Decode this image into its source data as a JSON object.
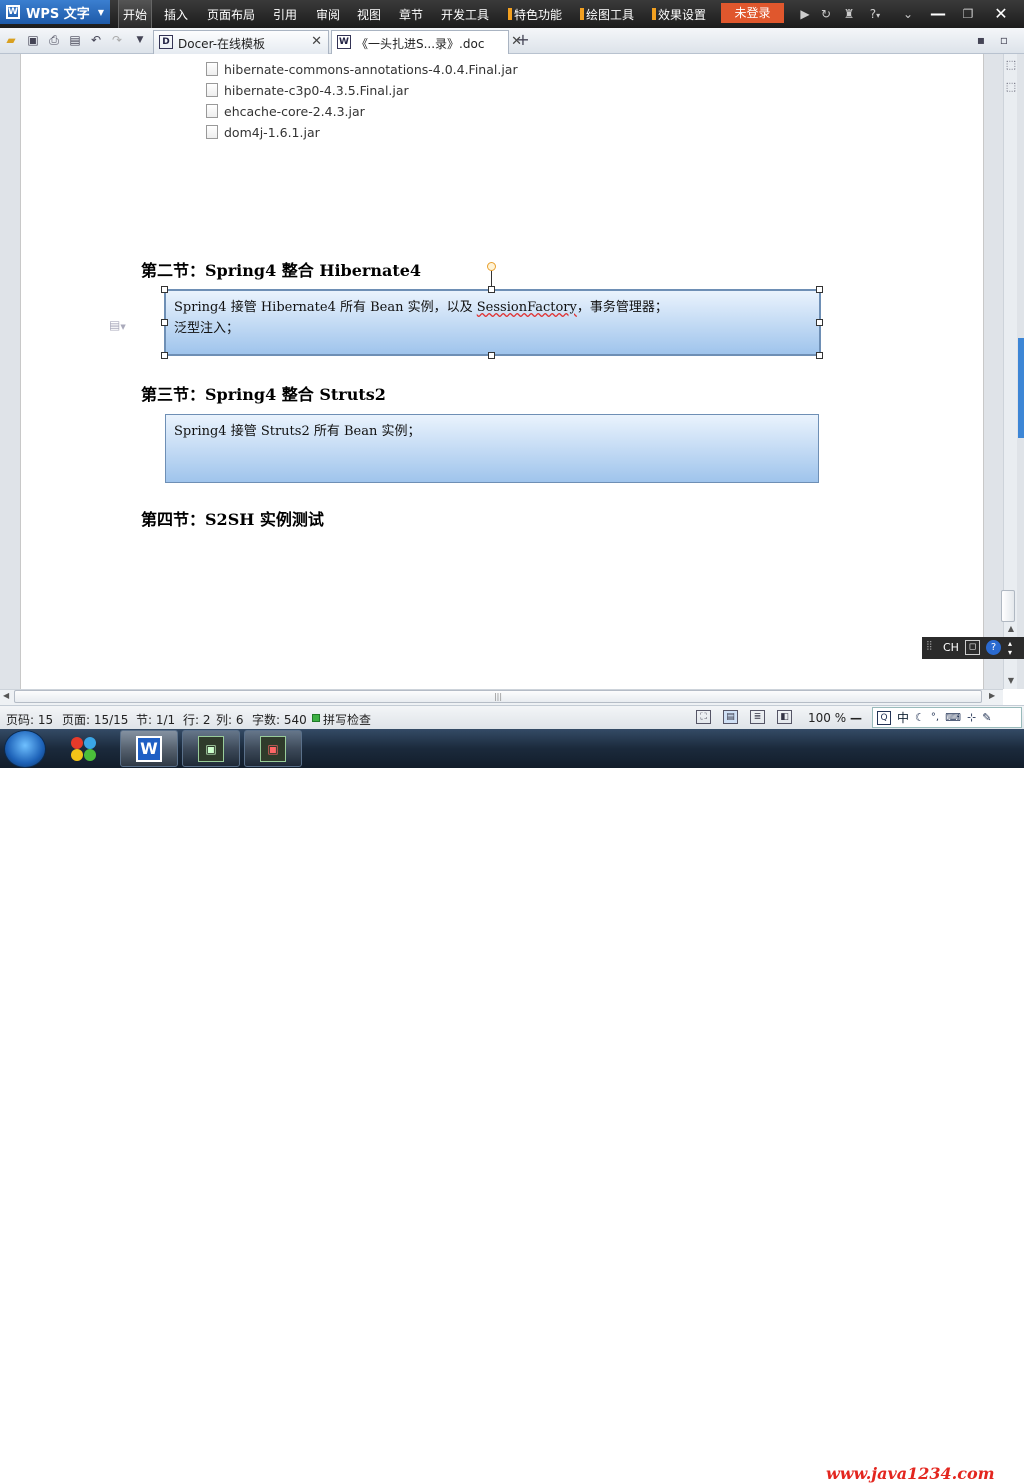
{
  "app": {
    "name": "WPS 文字"
  },
  "menubar": {
    "items": [
      "开始",
      "插入",
      "页面布局",
      "引用",
      "审阅",
      "视图",
      "章节",
      "开发工具",
      "特色功能",
      "绘图工具",
      "效果设置"
    ],
    "login_label": "未登录",
    "help_label": "?",
    "login_color": "#e0572d"
  },
  "tabs": [
    {
      "label": "Docer-在线模板",
      "icon": "D"
    },
    {
      "label": "《一头扎进S...录》.doc",
      "icon": "W"
    }
  ],
  "document": {
    "files": [
      "hibernate-commons-annotations-4.0.4.Final.jar",
      "hibernate-c3p0-4.3.5.Final.jar",
      "ehcache-core-2.4.3.jar",
      "dom4j-1.6.1.jar"
    ],
    "section2": {
      "heading": "第二节：Spring4 整合 Hibernate4",
      "line1_pre": "Spring4 接管 Hibernate4 所有 Bean 实例，以及 ",
      "line1_ul": "SessionFactory",
      "line1_post": "，事务管理器；",
      "line2": "泛型注入；"
    },
    "section3": {
      "heading": "第三节：Spring4 整合 Struts2",
      "text": "Spring4 接管 Struts2 所有 Bean 实例；"
    },
    "section4": {
      "heading": "第四节：S2SH 实例测试"
    }
  },
  "ime": {
    "mode": "CH"
  },
  "statusbar": {
    "page_code": "页码: 15",
    "page": "页面: 15/15",
    "section": "节: 1/1",
    "row": "行: 2",
    "col": "列: 6",
    "words": "字数: 540",
    "spell": "拼写检查",
    "zoom": "100 %",
    "ime_cn": "中"
  },
  "taskbar": {
    "apps": [
      "wps-writer",
      "app-2",
      "app-3"
    ]
  },
  "watermark": "www.java1234.com"
}
